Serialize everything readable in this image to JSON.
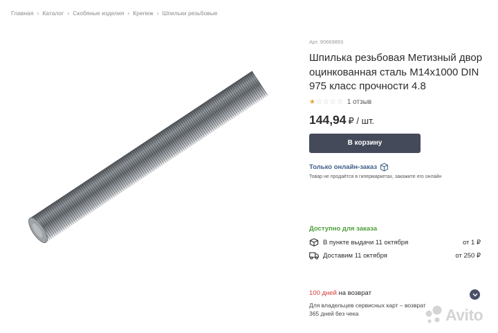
{
  "breadcrumb": [
    "Главная",
    "Каталог",
    "Скобяные изделия",
    "Крепеж",
    "Шпильки резьбовые"
  ],
  "product": {
    "sku": "Арт. 90669893",
    "title": "Шпилька резьбовая Метизный двор оцинкованная сталь М14х1000 DIN 975 класс прочности 4.8",
    "rating": 1,
    "rating_max": 5,
    "reviews": "1 отзыв",
    "price": "144,94",
    "unit": "₽ / шт.",
    "cart_button": "В корзину",
    "online_only": "Только онлайн-заказ",
    "online_note": "Товар не продаётся в гипермаркетах, закажите его онлайн"
  },
  "availability": {
    "label": "Доступно для заказа",
    "pickup": {
      "label": "В пункте выдачи 11 октября",
      "price": "от 1 ₽"
    },
    "delivery": {
      "label": "Доставим 11 октября",
      "price": "от 250 ₽"
    }
  },
  "returns": {
    "days": "100 дней",
    "text": "на возврат",
    "note": "Для владельцев сервисных карт – возврат 365 дней без чека"
  },
  "watermark": "Avito",
  "colors": {
    "button_bg": "#444a5a",
    "link": "#3d5f8a",
    "available": "#4e9e3a",
    "return_accent": "#d33a3a",
    "star": "#e8a23a"
  }
}
